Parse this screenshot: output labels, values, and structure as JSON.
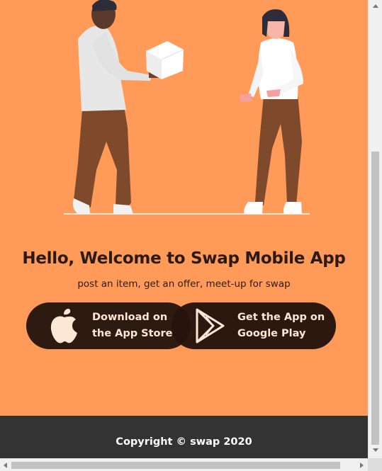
{
  "hero": {
    "title": "Hello, Welcome to Swap Mobile App",
    "subtitle": "post an item, get an offer, meet-up for swap",
    "background_color": "#ff9a58",
    "illustration": {
      "icon": "people-exchanging-box-illustration"
    }
  },
  "store_buttons": [
    {
      "icon": "apple-icon",
      "line1": "Download on",
      "line2": "the App Store"
    },
    {
      "icon": "google-play-icon",
      "line1": "Get the App on",
      "line2": "Google Play"
    }
  ],
  "footer": {
    "text": "Copyright © swap 2020",
    "background_color": "#333333"
  },
  "accent_text_color": "#ffe7d6"
}
